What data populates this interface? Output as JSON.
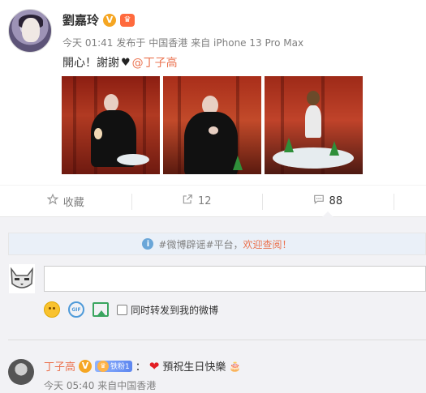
{
  "post": {
    "author": "劉嘉玲",
    "verified_badge": "V",
    "time": "今天 01:41",
    "published_from": "发布于 中国香港",
    "device": "来自 iPhone 13 Pro Max",
    "text": "開心！謝謝",
    "mention": "@丁子高",
    "images": [
      "photo-1",
      "photo-2",
      "photo-3"
    ]
  },
  "actions": {
    "favorite": {
      "label": "收藏",
      "icon": "star-icon"
    },
    "repost": {
      "count": "12",
      "icon": "share-icon"
    },
    "comment": {
      "count": "88",
      "icon": "comment-icon"
    }
  },
  "notice": {
    "text": "#微博辟谣#平台，",
    "link": "欢迎查阅！"
  },
  "composer": {
    "input_value": "",
    "repost_checkbox_label": "同时转发到我的微博",
    "repost_checked": false
  },
  "comments": [
    {
      "author": "丁子高",
      "verified_badge": "V",
      "fan_badge": "铁粉1",
      "text": "預祝生日快樂",
      "time": "今天 05:40",
      "location": "来自中国香港"
    }
  ],
  "colors": {
    "accent": "#eb7350",
    "muted": "#808080",
    "background_secondary": "#f2f2f5"
  }
}
